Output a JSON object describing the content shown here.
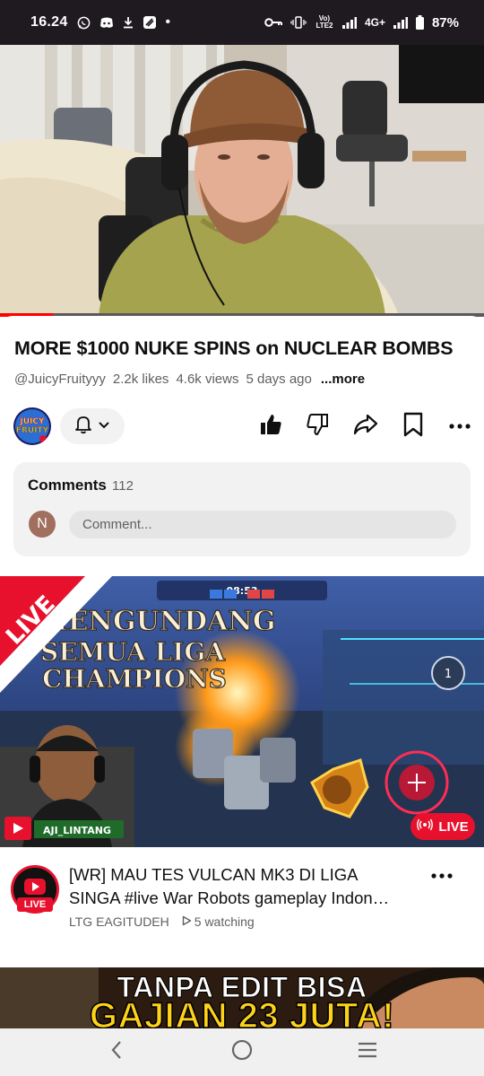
{
  "status_bar": {
    "time": "16.24",
    "dot": "•",
    "volte": "Vo) LTE2",
    "network": "4G+",
    "battery": "87%"
  },
  "player": {
    "progress_fraction": 0.11
  },
  "video": {
    "title": "MORE $1000 NUKE SPINS on NUCLEAR BOMBS",
    "channel_handle": "@JuicyFruityyy",
    "likes": "2.2k likes",
    "views": "4.6k views",
    "age": "5 days ago",
    "more_label": "...more",
    "channel_logo_text": "JUICY FRUITY"
  },
  "comments": {
    "heading": "Comments",
    "count": "112",
    "avatar_initial": "N",
    "placeholder": "Comment..."
  },
  "live_card": {
    "corner_label": "LIVE",
    "thumb_line1": "MENGUNDANG",
    "thumb_line2": "SEMUA LIGA",
    "thumb_line3": "CHAMPIONS",
    "streamer_name": "AJI_LINTANG",
    "badge_label": "LIVE",
    "title_line1": "[WR] MAU TES VULCAN MK3 DI LIGA",
    "title_line2": "SINGA #live War Robots gameplay Indon…",
    "channel_name": "LTG EAGITUDEH",
    "watching": "5 watching",
    "avatar_tag": "LIVE"
  },
  "next_card": {
    "line1": "TANPA EDIT BISA",
    "line2": "GAJIAN 23 JUTA!"
  },
  "colors": {
    "accent_red": "#ff0000",
    "live_red": "#e8112d",
    "text_primary": "#0f0f0f",
    "text_secondary": "#606060"
  }
}
